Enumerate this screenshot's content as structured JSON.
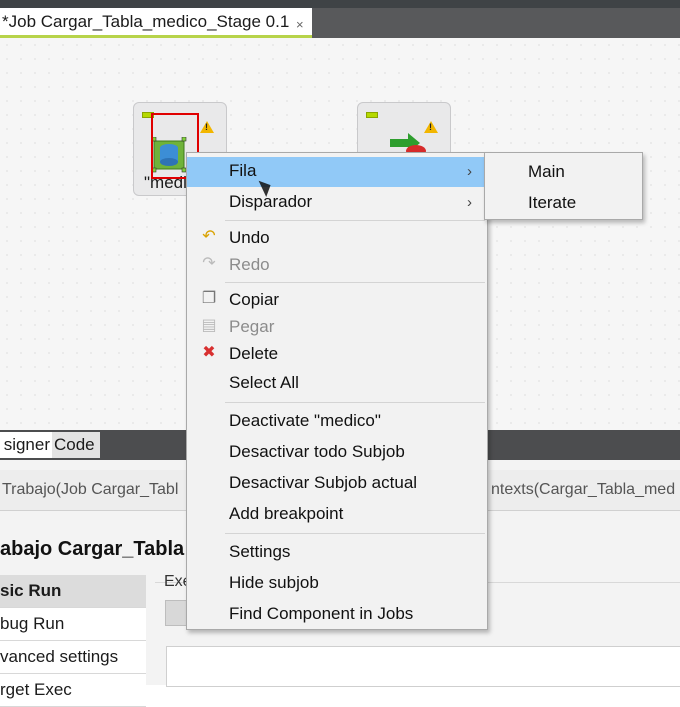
{
  "editor": {
    "tab_title": "*Job Cargar_Tabla_medico_Stage 0.1",
    "tab_close": "×"
  },
  "canvas": {
    "component_left_label": "\"medi",
    "component_left_icon": "database-input-icon",
    "component_right_icon": "map-output-icon"
  },
  "context_menu": {
    "items": [
      {
        "label": "Fila",
        "submenu": true
      },
      {
        "label": "Disparador",
        "submenu": true
      },
      {
        "label": "Undo",
        "icon": "undo-icon"
      },
      {
        "label": "Redo",
        "icon": "redo-icon",
        "disabled": true
      },
      {
        "label": "Copiar",
        "icon": "copy-icon"
      },
      {
        "label": "Pegar",
        "icon": "paste-icon",
        "disabled": true
      },
      {
        "label": "Delete",
        "icon": "delete-icon"
      },
      {
        "label": "Select All"
      },
      {
        "label": "Deactivate \"medico\""
      },
      {
        "label": "Desactivar todo Subjob"
      },
      {
        "label": "Desactivar Subjob actual"
      },
      {
        "label": "Add breakpoint"
      },
      {
        "label": "Settings"
      },
      {
        "label": "Hide subjob"
      },
      {
        "label": "Find Component in Jobs"
      }
    ],
    "arrow": "›"
  },
  "submenu": {
    "items": [
      {
        "label": "Main"
      },
      {
        "label": "Iterate"
      }
    ]
  },
  "bottom": {
    "tabs": [
      "signer",
      "Code"
    ],
    "run_job_label": "Trabajo(Job Cargar_Tabl",
    "contexts_label": "ntexts(Cargar_Tabla_med",
    "panel_title": "abajo Cargar_Tabla",
    "left_items": [
      "sic Run",
      "bug Run",
      "vanced settings",
      "rget Exec"
    ],
    "exec_label": "Exe"
  },
  "colors": {
    "highlight": "#91c9f7",
    "annotation_red": "#e00000",
    "tab_accent": "#b7d34a"
  }
}
